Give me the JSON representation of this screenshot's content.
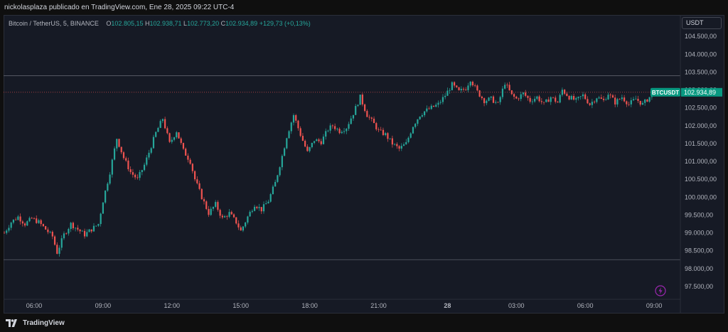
{
  "header": {
    "publisher_line": "nickolasplaza publicado en TradingView.com, Ene 28, 2025 09:22 UTC-4"
  },
  "legend": {
    "symbol": "Bitcoin / TetherUS, 5, BINANCE",
    "open_label": "O",
    "open": "102.805,15",
    "high_label": "H",
    "high": "102.938,71",
    "low_label": "L",
    "low": "102.773,20",
    "close_label": "C",
    "close": "102.934,89",
    "change": "+129,73 (+0,13%)"
  },
  "unit_selector": {
    "label": "USDT"
  },
  "footer": {
    "brand": "TradingView"
  },
  "colors": {
    "up": "#26a69a",
    "down": "#ef5350",
    "background": "#161a25",
    "grid_text": "#b2b5be",
    "price_tag": "#089981",
    "horizontal_line": "#5d606b",
    "flash_icon": "#9c27b0"
  },
  "chart_data": {
    "type": "candlestick",
    "symbol_tag": "BTCUSDT",
    "last_price": 102934.89,
    "last_price_label": "102.934,89",
    "ylim": [
      97300,
      105100
    ],
    "y_ticks": [
      {
        "value": 104500,
        "label": "104.500,00"
      },
      {
        "value": 104000,
        "label": "104.000,00"
      },
      {
        "value": 103500,
        "label": "103.500,00"
      },
      {
        "value": 103000,
        "label": "103.000,00"
      },
      {
        "value": 102500,
        "label": "102.500,00"
      },
      {
        "value": 102000,
        "label": "102.000,00"
      },
      {
        "value": 101500,
        "label": "101.500,00"
      },
      {
        "value": 101000,
        "label": "101.000,00"
      },
      {
        "value": 100500,
        "label": "100.500,00"
      },
      {
        "value": 100000,
        "label": "100.000,00"
      },
      {
        "value": 99500,
        "label": "99.500,00"
      },
      {
        "value": 99000,
        "label": "99.000,00"
      },
      {
        "value": 98500,
        "label": "98.500,00"
      },
      {
        "value": 98000,
        "label": "98.000,00"
      },
      {
        "value": 97500,
        "label": "97.500,00"
      }
    ],
    "x_ticks": [
      {
        "label": "06:00",
        "hours": 0
      },
      {
        "label": "09:00",
        "hours": 3
      },
      {
        "label": "12:00",
        "hours": 6
      },
      {
        "label": "15:00",
        "hours": 9
      },
      {
        "label": "18:00",
        "hours": 12
      },
      {
        "label": "21:00",
        "hours": 15
      },
      {
        "label": "28",
        "hours": 18
      },
      {
        "label": "03:00",
        "hours": 21
      },
      {
        "label": "06:00",
        "hours": 24
      },
      {
        "label": "09:00",
        "hours": 27
      }
    ],
    "horizontal_lines": [
      103400,
      98250
    ],
    "close_series": [
      {
        "h": -1.3,
        "c": 99000
      },
      {
        "h": -1.0,
        "c": 99300
      },
      {
        "h": -0.7,
        "c": 99450
      },
      {
        "h": -0.4,
        "c": 99250
      },
      {
        "h": -0.1,
        "c": 99400
      },
      {
        "h": 0.2,
        "c": 99300
      },
      {
        "h": 0.5,
        "c": 99100
      },
      {
        "h": 0.8,
        "c": 98900
      },
      {
        "h": 1.0,
        "c": 98450
      },
      {
        "h": 1.3,
        "c": 98950
      },
      {
        "h": 1.6,
        "c": 99250
      },
      {
        "h": 1.9,
        "c": 99100
      },
      {
        "h": 2.2,
        "c": 98950
      },
      {
        "h": 2.5,
        "c": 99100
      },
      {
        "h": 2.8,
        "c": 99250
      },
      {
        "h": 3.0,
        "c": 99900
      },
      {
        "h": 3.3,
        "c": 100700
      },
      {
        "h": 3.6,
        "c": 101650
      },
      {
        "h": 3.9,
        "c": 101100
      },
      {
        "h": 4.2,
        "c": 100700
      },
      {
        "h": 4.5,
        "c": 100500
      },
      {
        "h": 4.8,
        "c": 100900
      },
      {
        "h": 5.0,
        "c": 101250
      },
      {
        "h": 5.3,
        "c": 101800
      },
      {
        "h": 5.6,
        "c": 102200
      },
      {
        "h": 5.9,
        "c": 101500
      },
      {
        "h": 6.2,
        "c": 101850
      },
      {
        "h": 6.5,
        "c": 101300
      },
      {
        "h": 6.8,
        "c": 101000
      },
      {
        "h": 7.0,
        "c": 100500
      },
      {
        "h": 7.3,
        "c": 100000
      },
      {
        "h": 7.6,
        "c": 99550
      },
      {
        "h": 7.9,
        "c": 99800
      },
      {
        "h": 8.2,
        "c": 99400
      },
      {
        "h": 8.5,
        "c": 99550
      },
      {
        "h": 8.8,
        "c": 99300
      },
      {
        "h": 9.0,
        "c": 99050
      },
      {
        "h": 9.3,
        "c": 99450
      },
      {
        "h": 9.6,
        "c": 99800
      },
      {
        "h": 9.9,
        "c": 99650
      },
      {
        "h": 10.2,
        "c": 99900
      },
      {
        "h": 10.5,
        "c": 100400
      },
      {
        "h": 10.8,
        "c": 101150
      },
      {
        "h": 11.0,
        "c": 101700
      },
      {
        "h": 11.3,
        "c": 102300
      },
      {
        "h": 11.6,
        "c": 101750
      },
      {
        "h": 11.9,
        "c": 101250
      },
      {
        "h": 12.2,
        "c": 101600
      },
      {
        "h": 12.5,
        "c": 101550
      },
      {
        "h": 12.8,
        "c": 101900
      },
      {
        "h": 13.0,
        "c": 102000
      },
      {
        "h": 13.3,
        "c": 101850
      },
      {
        "h": 13.6,
        "c": 101950
      },
      {
        "h": 13.9,
        "c": 102350
      },
      {
        "h": 14.2,
        "c": 102800
      },
      {
        "h": 14.5,
        "c": 102300
      },
      {
        "h": 14.8,
        "c": 102050
      },
      {
        "h": 15.0,
        "c": 101850
      },
      {
        "h": 15.3,
        "c": 101750
      },
      {
        "h": 15.6,
        "c": 101500
      },
      {
        "h": 15.9,
        "c": 101350
      },
      {
        "h": 16.2,
        "c": 101500
      },
      {
        "h": 16.5,
        "c": 102000
      },
      {
        "h": 16.8,
        "c": 102300
      },
      {
        "h": 17.0,
        "c": 102400
      },
      {
        "h": 17.3,
        "c": 102500
      },
      {
        "h": 17.6,
        "c": 102600
      },
      {
        "h": 17.9,
        "c": 102850
      },
      {
        "h": 18.2,
        "c": 103150
      },
      {
        "h": 18.5,
        "c": 102950
      },
      {
        "h": 18.8,
        "c": 103050
      },
      {
        "h": 19.0,
        "c": 103300
      },
      {
        "h": 19.3,
        "c": 102950
      },
      {
        "h": 19.6,
        "c": 102700
      },
      {
        "h": 19.9,
        "c": 102750
      },
      {
        "h": 20.2,
        "c": 102600
      },
      {
        "h": 20.5,
        "c": 103200
      },
      {
        "h": 20.8,
        "c": 102850
      },
      {
        "h": 21.0,
        "c": 102750
      },
      {
        "h": 21.3,
        "c": 102900
      },
      {
        "h": 21.6,
        "c": 102700
      },
      {
        "h": 21.9,
        "c": 102800
      },
      {
        "h": 22.2,
        "c": 102600
      },
      {
        "h": 22.5,
        "c": 102800
      },
      {
        "h": 22.8,
        "c": 102650
      },
      {
        "h": 23.0,
        "c": 103000
      },
      {
        "h": 23.3,
        "c": 102800
      },
      {
        "h": 23.6,
        "c": 102700
      },
      {
        "h": 23.9,
        "c": 102850
      },
      {
        "h": 24.2,
        "c": 102600
      },
      {
        "h": 24.5,
        "c": 102800
      },
      {
        "h": 24.8,
        "c": 102700
      },
      {
        "h": 25.0,
        "c": 102900
      },
      {
        "h": 25.3,
        "c": 102650
      },
      {
        "h": 25.6,
        "c": 102800
      },
      {
        "h": 25.9,
        "c": 102600
      },
      {
        "h": 26.2,
        "c": 102750
      },
      {
        "h": 26.5,
        "c": 102600
      },
      {
        "h": 26.8,
        "c": 102800
      },
      {
        "h": 27.0,
        "c": 102934.89
      }
    ]
  }
}
